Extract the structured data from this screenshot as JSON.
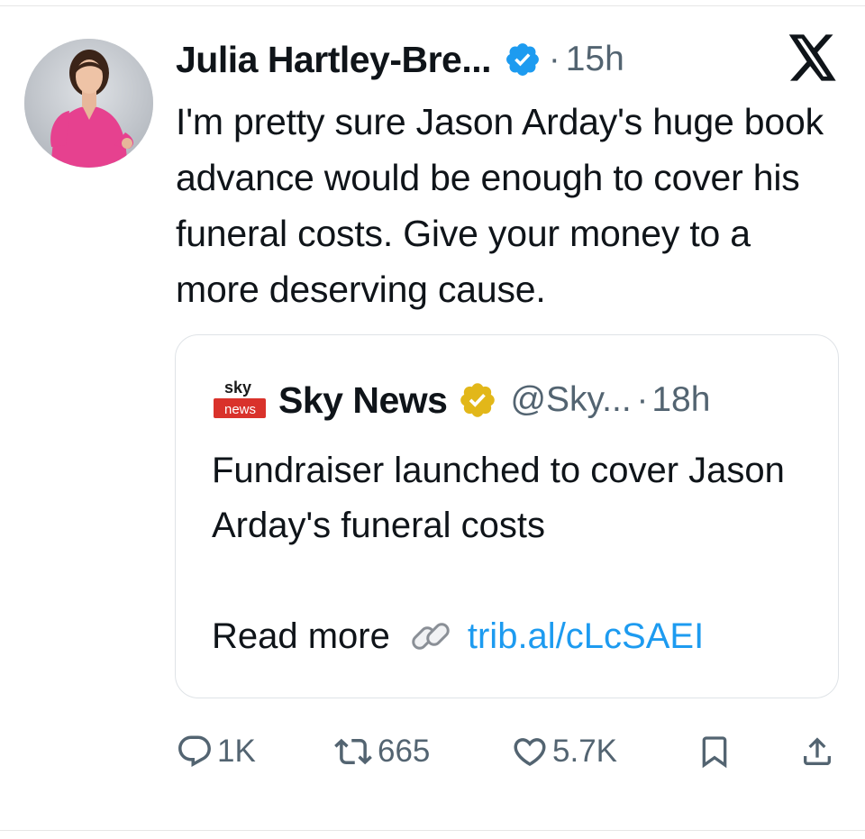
{
  "tweet": {
    "author_name": "Julia Hartley-Bre...",
    "separator": "·",
    "time": "15h",
    "text": "I'm pretty sure Jason Arday's huge book advance would be enough to cover his funeral costs. Give your money to a more deserving cause."
  },
  "quoted": {
    "name": "Sky News",
    "handle": "@Sky...",
    "separator": "·",
    "time": "18h",
    "text": "Fundraiser launched to cover Jason Arday's funeral costs",
    "read_more": "Read more",
    "link": "trib.al/cLcSAEI",
    "logo_text_top": "sky",
    "logo_text_bottom": "news"
  },
  "actions": {
    "replies": "1K",
    "reposts": "665",
    "likes": "5.7K"
  },
  "icons": {
    "verified": "verified-badge-icon",
    "gold_verified": "gold-verified-badge-icon",
    "x_logo": "x-logo-icon",
    "reply": "reply-icon",
    "repost": "repost-icon",
    "like": "heart-icon",
    "bookmark": "bookmark-icon",
    "share": "share-icon",
    "link": "link-icon"
  },
  "colors": {
    "accent": "#1d9bf0",
    "muted": "#536471",
    "gold": "#e2b719",
    "sky_red": "#d9322b"
  }
}
